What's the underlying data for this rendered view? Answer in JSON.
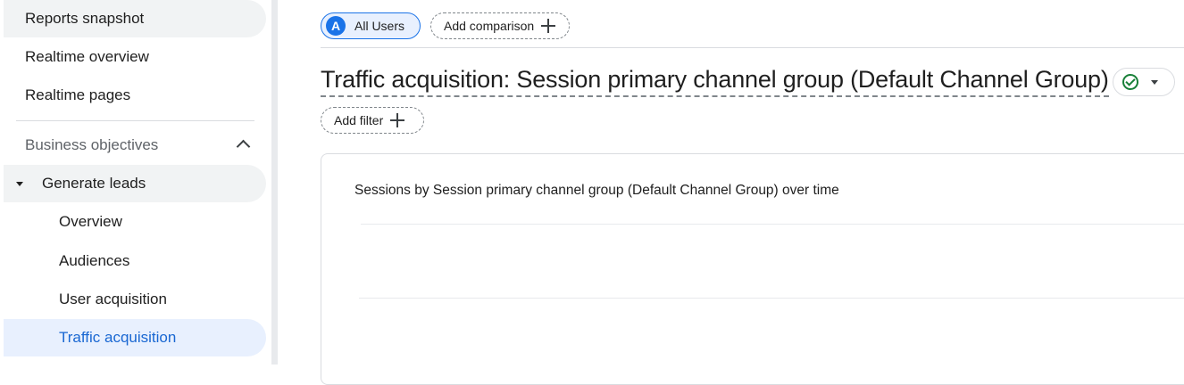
{
  "sidebar": {
    "items": [
      {
        "label": "Reports snapshot"
      },
      {
        "label": "Realtime overview"
      },
      {
        "label": "Realtime pages"
      },
      {
        "label": "Business objectives"
      },
      {
        "label": "Generate leads"
      },
      {
        "label": "Overview"
      },
      {
        "label": "Audiences"
      },
      {
        "label": "User acquisition"
      },
      {
        "label": "Traffic acquisition"
      }
    ]
  },
  "comparisons": {
    "all_users": {
      "avatar_letter": "A",
      "label": "All Users"
    },
    "add_comparison_label": "Add comparison"
  },
  "page": {
    "title": "Traffic acquisition: Session primary channel group (Default Channel Group)",
    "add_filter_label": "Add filter"
  },
  "card": {
    "title": "Sessions by Session primary channel group (Default Channel Group) over time"
  },
  "colors": {
    "accent": "#1a73e8",
    "active_text": "#1967d2",
    "active_bg": "#e8f0fe",
    "success": "#188038"
  }
}
